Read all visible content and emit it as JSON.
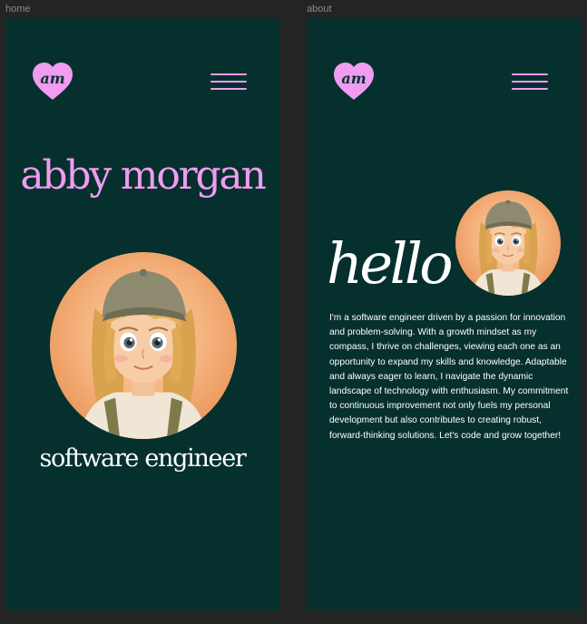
{
  "frames": {
    "home": {
      "label": "home"
    },
    "about": {
      "label": "about"
    }
  },
  "logo": {
    "text": "am"
  },
  "home": {
    "name": "abby morgan",
    "role": "software engineer"
  },
  "about": {
    "heading": "hello",
    "body": "I'm a software engineer driven by a passion for innovation and problem-solving. With a growth mindset as my compass, I thrive on challenges, viewing each one as an opportunity to expand my skills and knowledge. Adaptable and always eager to learn, I navigate the dynamic landscape of technology with enthusiasm. My commitment to continuous improvement not only fuels my personal development but also contributes to creating robust, forward-thinking solutions. Let's code and grow together!"
  },
  "colors": {
    "background": "#06302d",
    "accent": "#f09cf0",
    "text": "#ffffff",
    "canvas": "#242424"
  },
  "icons": {
    "menu": "hamburger-icon",
    "logo": "heart-logo-icon"
  }
}
